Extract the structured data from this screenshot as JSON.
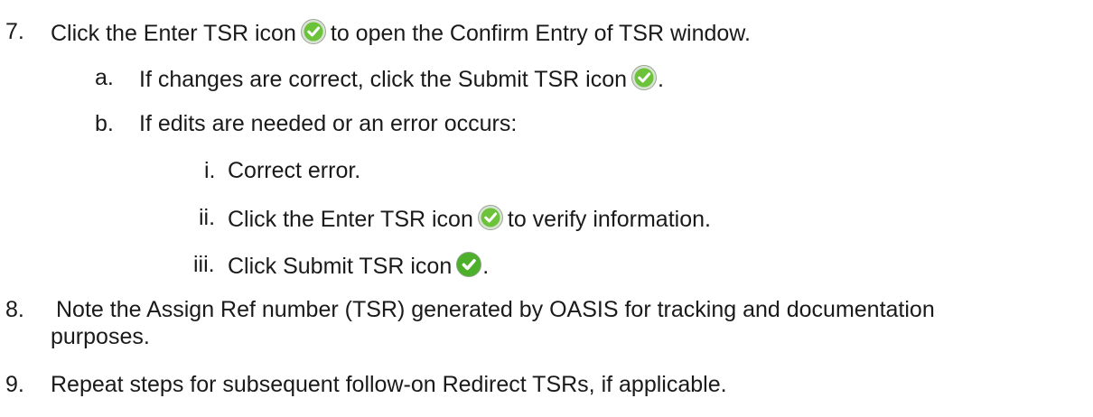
{
  "steps": [
    {
      "number": "7.",
      "before": "Click the Enter TSR icon",
      "icon": "green-check-circle-icon",
      "after": "to open the Confirm Entry of TSR window."
    },
    {
      "number": "a.",
      "before": "If changes are correct, click the Submit TSR icon",
      "icon": "green-check-circle-icon",
      "after": "."
    },
    {
      "number": "b.",
      "text": "If edits are needed or an error occurs:"
    },
    {
      "number": "i.",
      "text": "Correct error."
    },
    {
      "number": "ii.",
      "before": "Click the Enter TSR icon",
      "icon": "green-check-circle-icon",
      "after": "to verify information."
    },
    {
      "number": "iii.",
      "before": "Click Submit TSR icon",
      "icon": "green-check-circle-icon-bold",
      "after": "."
    },
    {
      "number": "8.",
      "line1": "Note the Assign Ref number (TSR) generated by OASIS for tracking and documentation",
      "line2": "purposes."
    },
    {
      "number": "9.",
      "text": "Repeat steps for subsequent follow-on Redirect TSRs, if applicable."
    }
  ],
  "colors": {
    "icon_fill": "#6cc33a",
    "icon_ring": "#bfc8b8",
    "text": "#1a1a1a"
  }
}
